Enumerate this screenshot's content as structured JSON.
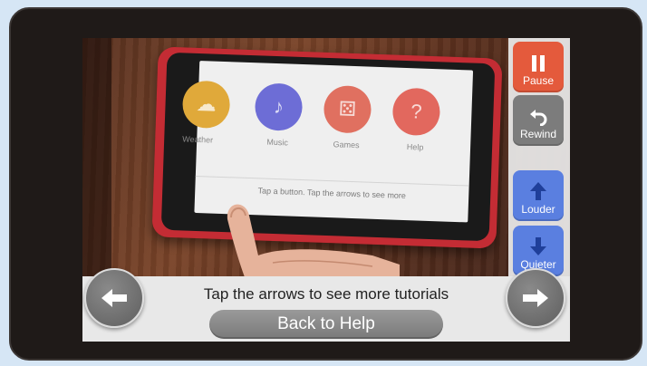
{
  "tablet_apps": [
    {
      "label": "Weather",
      "color": "#e0a93a",
      "icon": "cloud-icon"
    },
    {
      "label": "Music",
      "color": "#6d6dd6",
      "icon": "music-note-icon"
    },
    {
      "label": "Games",
      "color": "#e07060",
      "icon": "dice-icon"
    },
    {
      "label": "Help",
      "color": "#e2685e",
      "icon": "question-icon"
    }
  ],
  "tablet_status": "Tap a button. Tap the arrows to see more",
  "controls": {
    "pause": {
      "label": "Pause",
      "color": "#e45a3c",
      "icon": "pause-icon"
    },
    "rewind": {
      "label": "Rewind",
      "color": "#7c7c7c",
      "icon": "rewind-icon"
    },
    "louder": {
      "label": "Louder",
      "color": "#5a7fe0",
      "icon": "arrow-up-icon"
    },
    "quieter": {
      "label": "Quieter",
      "color": "#5a7fe0",
      "icon": "arrow-down-icon"
    }
  },
  "bottom": {
    "prompt": "Tap the arrows to see more tutorials",
    "back_label": "Back to Help"
  },
  "nav": {
    "prev_icon": "arrow-left-icon",
    "next_icon": "arrow-right-icon"
  }
}
